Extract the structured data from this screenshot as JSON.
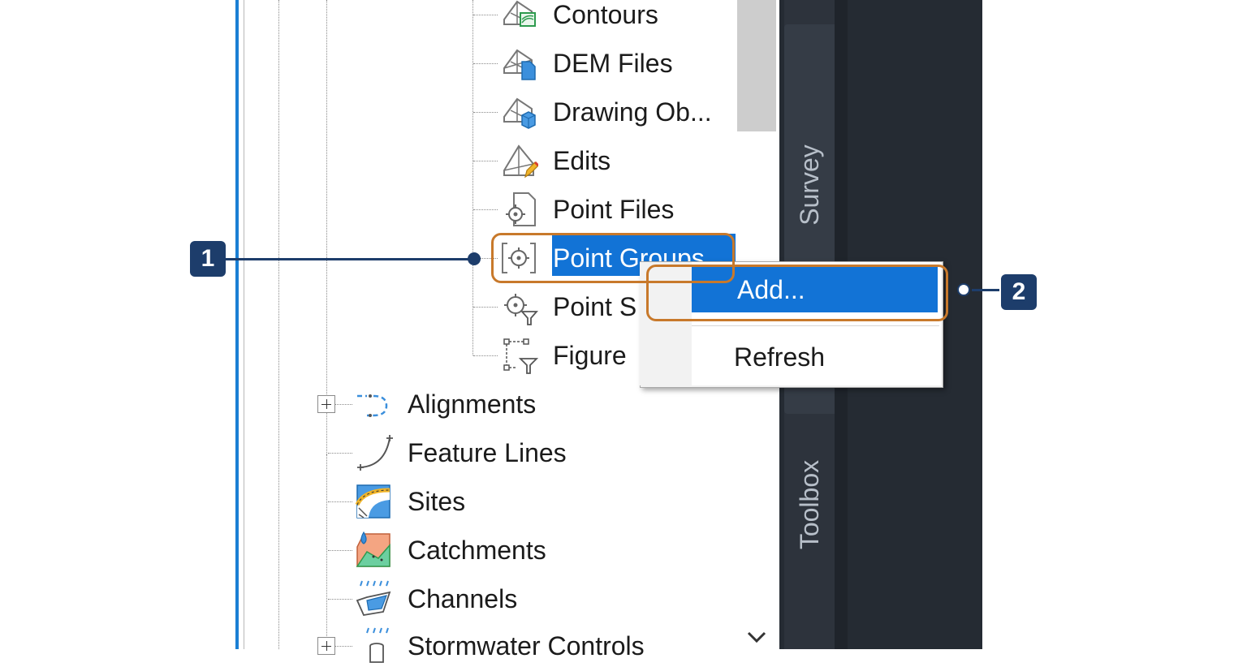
{
  "tree": {
    "survey_children": [
      {
        "label": "Contours",
        "icon": "contours-icon"
      },
      {
        "label": "DEM Files",
        "icon": "dem-files-icon"
      },
      {
        "label": "Drawing Ob...",
        "icon": "drawing-objects-icon"
      },
      {
        "label": "Edits",
        "icon": "edits-icon"
      },
      {
        "label": "Point Files",
        "icon": "point-files-icon"
      },
      {
        "label": "Point Groups",
        "icon": "point-groups-icon",
        "selected": true
      },
      {
        "label": "Point S",
        "icon": "point-surveys-icon"
      },
      {
        "label": "Figure",
        "icon": "figure-icon"
      }
    ],
    "top_items": [
      {
        "label": "Alignments",
        "icon": "alignments-icon",
        "expandable": true
      },
      {
        "label": "Feature Lines",
        "icon": "feature-lines-icon"
      },
      {
        "label": "Sites",
        "icon": "sites-icon"
      },
      {
        "label": "Catchments",
        "icon": "catchments-icon"
      },
      {
        "label": "Channels",
        "icon": "channels-icon"
      },
      {
        "label": "Stormwater Controls",
        "icon": "stormwater-controls-icon",
        "expandable": true
      }
    ]
  },
  "context_menu": {
    "add_label": "Add...",
    "refresh_label": "Refresh"
  },
  "side_tabs": {
    "survey": "Survey",
    "toolbox": "Toolbox"
  },
  "callouts": {
    "one": "1",
    "two": "2"
  },
  "colors": {
    "selection": "#1273d6",
    "callout_outline": "#c8792b",
    "callout_badge": "#1d3d6b",
    "panel_border": "#1a7fd4",
    "dark_bg": "#252b33"
  }
}
